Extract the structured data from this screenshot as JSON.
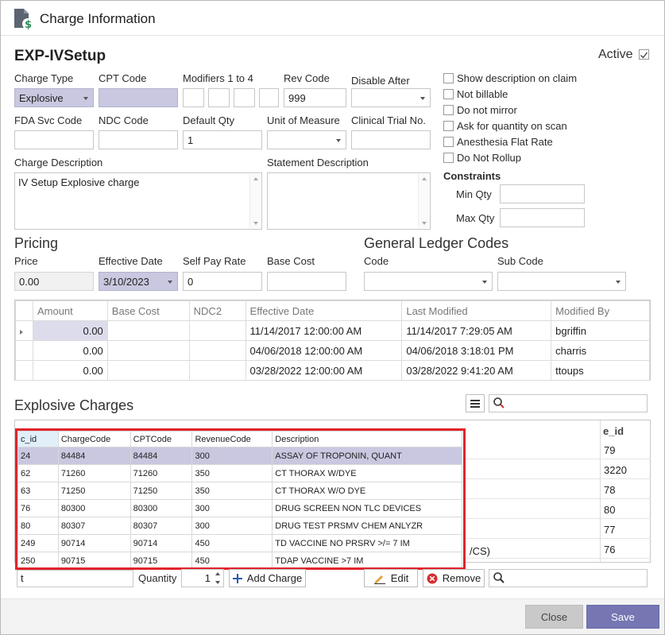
{
  "window": {
    "title": "Charge Information",
    "icon": "charge-document-dollar-icon"
  },
  "header": {
    "name": "EXP-IVSetup",
    "active_label": "Active",
    "active_checked": true
  },
  "fields": {
    "charge_type": {
      "label": "Charge Type",
      "value": "Explosive"
    },
    "cpt_code": {
      "label": "CPT Code",
      "value": ""
    },
    "modifiers": {
      "label": "Modifiers 1 to 4"
    },
    "rev_code": {
      "label": "Rev Code",
      "value": "999"
    },
    "disable_after": {
      "label": "Disable After",
      "value": ""
    },
    "fda_svc_code": {
      "label": "FDA Svc Code",
      "value": ""
    },
    "ndc_code": {
      "label": "NDC Code",
      "value": ""
    },
    "default_qty": {
      "label": "Default Qty",
      "value": "1"
    },
    "unit_of_measure": {
      "label": "Unit of Measure",
      "value": ""
    },
    "clinical_trial": {
      "label": "Clinical Trial No.",
      "value": ""
    },
    "charge_description": {
      "label": "Charge Description",
      "value": "IV Setup Explosive charge"
    },
    "statement_description": {
      "label": "Statement Description",
      "value": ""
    }
  },
  "options": [
    {
      "label": "Show description on claim",
      "checked": false
    },
    {
      "label": "Not billable",
      "checked": false
    },
    {
      "label": "Do not mirror",
      "checked": false
    },
    {
      "label": "Ask for quantity on scan",
      "checked": false
    },
    {
      "label": "Anesthesia Flat Rate",
      "checked": false
    },
    {
      "label": "Do Not Rollup",
      "checked": false
    }
  ],
  "constraints": {
    "title": "Constraints",
    "min_label": "Min Qty",
    "max_label": "Max Qty"
  },
  "pricing": {
    "title": "Pricing",
    "price_label": "Price",
    "price_value": "0.00",
    "effective_label": "Effective Date",
    "effective_value": "3/10/2023",
    "selfpay_label": "Self Pay Rate",
    "selfpay_value": "0",
    "basecost_label": "Base Cost",
    "basecost_value": ""
  },
  "gl": {
    "title": "General Ledger Codes",
    "code_label": "Code",
    "subcode_label": "Sub Code"
  },
  "price_grid": {
    "headers": [
      "Amount",
      "Base Cost",
      "NDC2",
      "Effective Date",
      "Last Modified",
      "Modified By"
    ],
    "rows": [
      [
        "0.00",
        "",
        "",
        "11/14/2017 12:00:00 AM",
        "11/14/2017 7:29:05 AM",
        "bgriffin"
      ],
      [
        "0.00",
        "",
        "",
        "04/06/2018 12:00:00 AM",
        "04/06/2018 3:18:01 PM",
        "charris"
      ],
      [
        "0.00",
        "",
        "",
        "03/28/2022 12:00:00 AM",
        "03/28/2022 9:41:20 AM",
        "ttoups"
      ]
    ]
  },
  "explosive": {
    "title": "Explosive Charges",
    "behind_header_right": "e_id",
    "behind_ids": [
      "79",
      "3220",
      "78",
      "80",
      "77",
      "76"
    ],
    "behind_partial_text": "/CS)",
    "search_input": "t",
    "quantity_label": "Quantity",
    "quantity_value": "1",
    "add_label": "Add Charge",
    "edit_label": "Edit",
    "remove_label": "Remove"
  },
  "lookup": {
    "headers": [
      "c_id",
      "ChargeCode",
      "CPTCode",
      "RevenueCode",
      "Description"
    ],
    "rows": [
      [
        "24",
        "84484",
        "84484",
        "300",
        "ASSAY OF TROPONIN, QUANT"
      ],
      [
        "62",
        "71260",
        "71260",
        "350",
        "CT THORAX W/DYE"
      ],
      [
        "63",
        "71250",
        "71250",
        "350",
        "CT THORAX W/O DYE"
      ],
      [
        "76",
        "80300",
        "80300",
        "300",
        "DRUG SCREEN NON TLC DEVICES"
      ],
      [
        "80",
        "80307",
        "80307",
        "300",
        "DRUG TEST PRSMV CHEM ANLYZR"
      ],
      [
        "249",
        "90714",
        "90714",
        "450",
        "TD VACCINE NO PRSRV >/= 7 IM"
      ],
      [
        "250",
        "90715",
        "90715",
        "450",
        "TDAP VACCINE >7 IM"
      ]
    ]
  },
  "footer": {
    "close_label": "Close",
    "save_label": "Save"
  },
  "colors": {
    "accent": "#7676b3",
    "selection": "#c9c8e0",
    "highlight_border": "#e0242c"
  }
}
